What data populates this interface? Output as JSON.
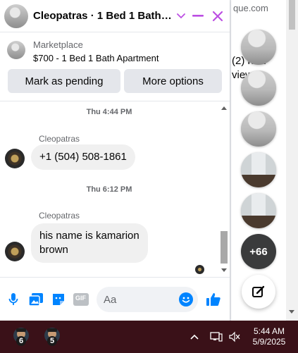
{
  "background_page": {
    "url_fragment": "que.com",
    "snippet_lines": [
      "(2) new",
      "view"
    ]
  },
  "chat": {
    "title": "Cleopatras · 1 Bed 1 Bath A...",
    "listing": {
      "source": "Marketplace",
      "title": "$700 - 1 Bed 1 Bath Apartment"
    },
    "buttons": {
      "mark_pending": "Mark as pending",
      "more_options": "More options"
    },
    "messages": [
      {
        "timestamp": "Thu 4:44 PM",
        "sender": "Cleopatras",
        "text": "+1 (504) 508-1861"
      },
      {
        "timestamp": "Thu 6:12 PM",
        "sender": "Cleopatras",
        "text_lines": [
          "his name is kamarion",
          "brown"
        ]
      }
    ],
    "composer": {
      "placeholder": "Aa",
      "gif_label": "GIF"
    }
  },
  "chat_heads": {
    "more_count": "+66"
  },
  "taskbar": {
    "apps": [
      {
        "badge": "6"
      },
      {
        "badge": "5"
      }
    ],
    "time": "5:44 AM",
    "date": "5/9/2025"
  },
  "colors": {
    "accent": "#0084ff",
    "header_icons": "#bc4ee3",
    "taskbar": "#3a1118"
  }
}
